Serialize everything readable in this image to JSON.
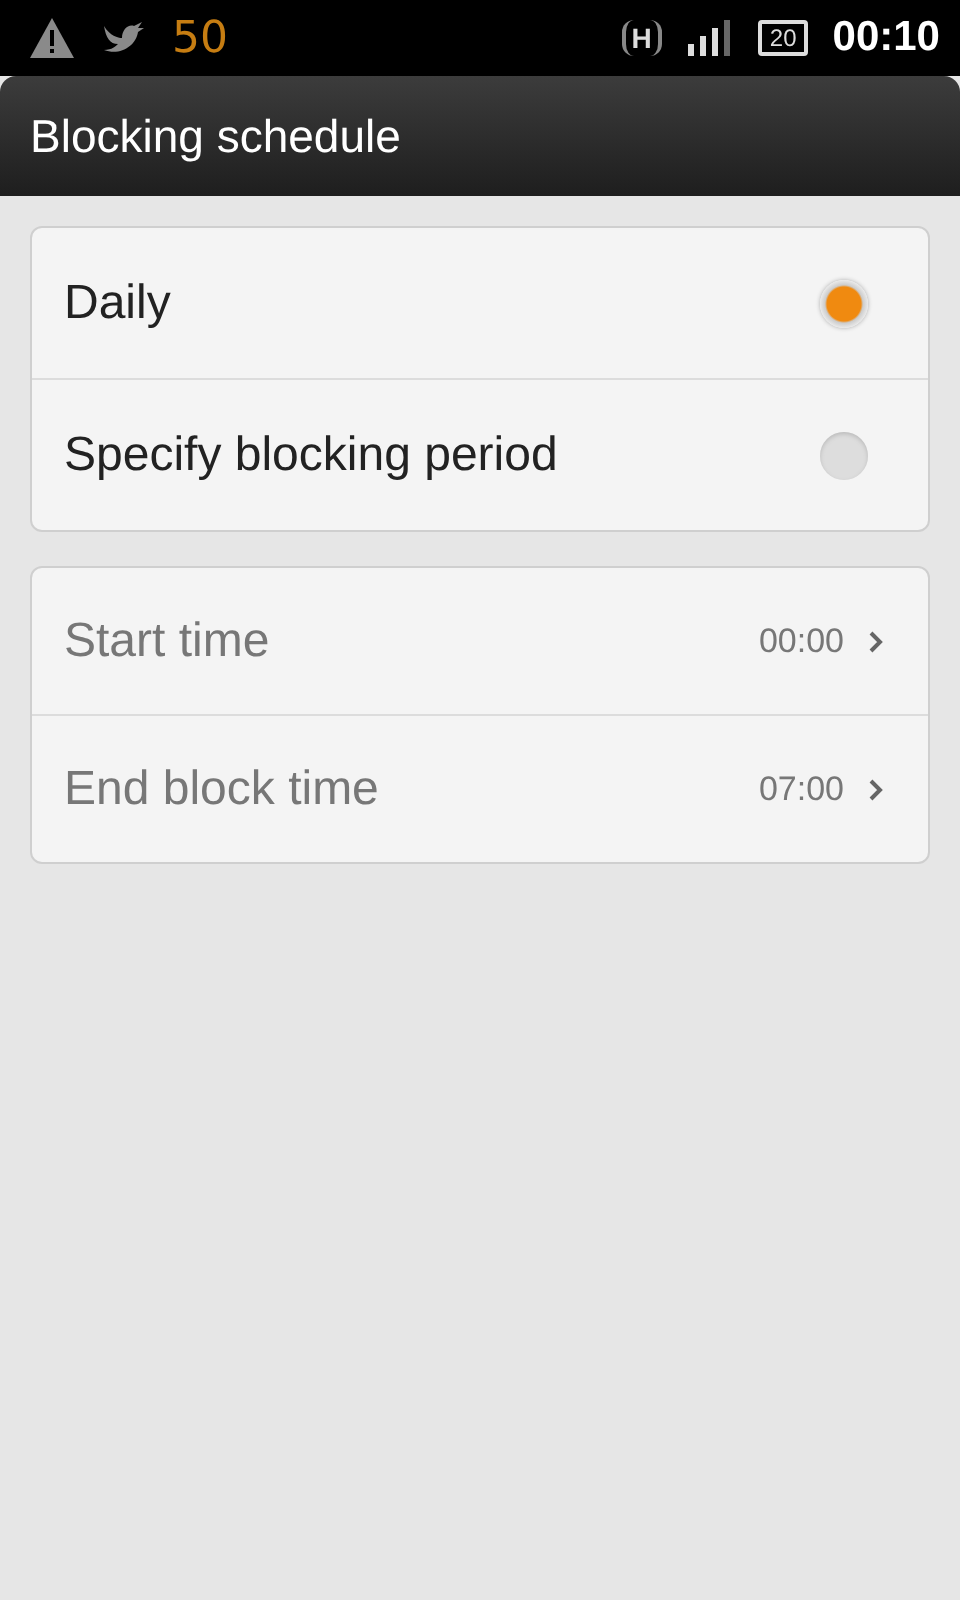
{
  "status_bar": {
    "notification_count": "50",
    "network_type": "H",
    "battery": "20",
    "time": "00:10"
  },
  "title_bar": {
    "title": "Blocking schedule"
  },
  "mode_options": [
    {
      "label": "Daily",
      "selected": true
    },
    {
      "label": "Specify blocking period",
      "selected": false
    }
  ],
  "time_settings": [
    {
      "label": "Start time",
      "value": "00:00",
      "disabled": true
    },
    {
      "label": "End block time",
      "value": "07:00",
      "disabled": true
    }
  ]
}
